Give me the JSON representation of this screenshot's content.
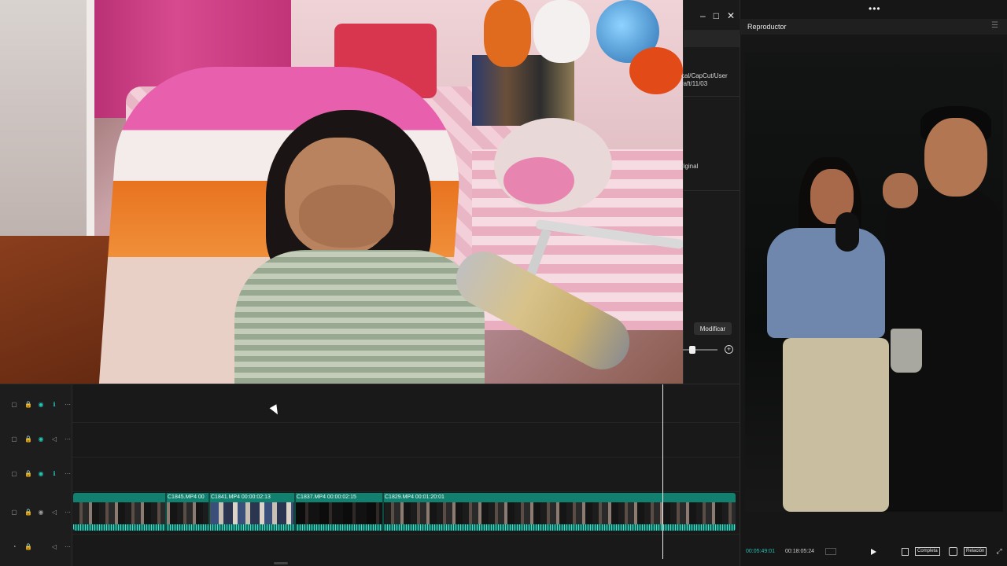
{
  "window": {
    "dots": "•••",
    "controls": [
      "–",
      "□",
      "✕"
    ]
  },
  "editor_strip": {
    "path_text": "cal/CapCut/User\nraft/11/03",
    "original_text": "riginal",
    "modify_button": "Modificar",
    "zoom_plus": "+"
  },
  "timeline": {
    "tracks": [
      {
        "name": "track-1",
        "icons": [
          "▢",
          "🔒",
          "◉",
          "ℹ",
          "⋯"
        ]
      },
      {
        "name": "track-2",
        "icons": [
          "▢",
          "🔒",
          "◉",
          "◁",
          "⋯"
        ]
      },
      {
        "name": "track-3",
        "icons": [
          "▢",
          "🔒",
          "◉",
          "ℹ",
          "⋯"
        ]
      },
      {
        "name": "track-main",
        "icons": [
          "▢",
          "🔒",
          "◉",
          "◁",
          "⋯"
        ]
      },
      {
        "name": "track-audio",
        "icons": [
          "◔",
          "🔒",
          "",
          "◁",
          "⋯"
        ]
      }
    ],
    "clips": [
      {
        "label": "C1845.MP4  00"
      },
      {
        "label": "C1841.MP4  00:00:02:13"
      },
      {
        "label": "C1837.MP4  00:00:02:15"
      },
      {
        "label": "C1829.MP4  00:01:20:01"
      }
    ]
  },
  "player": {
    "title": "Reproductor",
    "menu": "☰",
    "time_current": "00:05:49:01",
    "time_total": "00:18:05:24",
    "fit_button": "Completa",
    "ratio_button": "Relación",
    "accent_color": "#26bfb3"
  }
}
